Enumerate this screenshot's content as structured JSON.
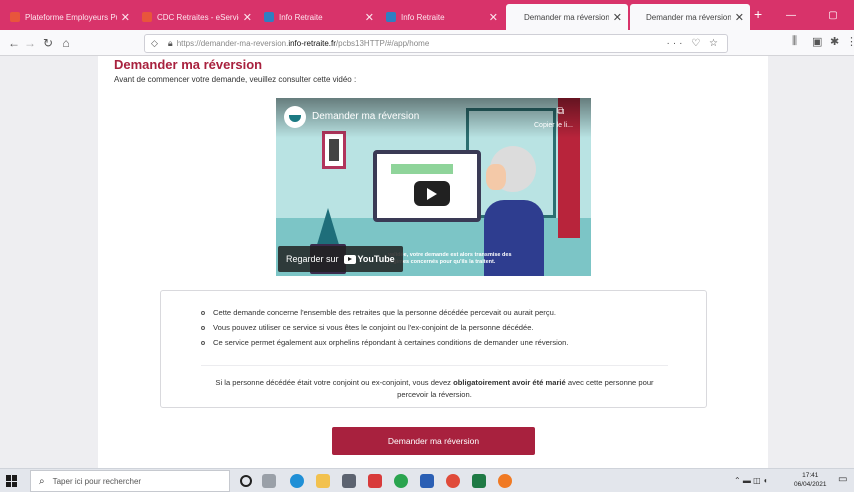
{
  "browser": {
    "tabs": [
      {
        "title": "Plateforme Employeurs Public",
        "favicon_color": "#e8553c"
      },
      {
        "title": "CDC Retraites - eServices",
        "favicon_color": "#e8553c"
      },
      {
        "title": "Info Retraite",
        "favicon_color": "#2f7fc1"
      },
      {
        "title": "Info Retraite",
        "favicon_color": "#2f7fc1"
      },
      {
        "title": "Demander ma réversion en lig",
        "favicon_color": "#2f7fc1"
      },
      {
        "title": "Demander ma réversion en lig",
        "favicon_color": "#2f7fc1"
      }
    ],
    "new_tab": "+",
    "url_prefix": "https://demander-ma-reversion.",
    "url_host": "info-retraite.fr",
    "url_path": "/pcbs13HTTP/#/app/home"
  },
  "page": {
    "title": "Demander ma réversion",
    "intro": "Avant de commencer votre demande, veuillez consulter cette vidéo :",
    "video": {
      "title": "Demander ma réversion",
      "copy_label": "Copier le li...",
      "watch_label": "Regarder sur",
      "youtube_label": "YouTube",
      "caption": "validée, votre demande est alors transmise des régimes concernés pour qu'ils la traitent."
    },
    "bullets": [
      "Cette demande concerne l'ensemble des retraites que la personne décédée percevait ou aurait perçu.",
      "Vous pouvez utiliser ce service si vous êtes le conjoint ou l'ex-conjoint de la personne décédée.",
      "Ce service permet également aux orphelins répondant à certaines conditions de demander une réversion."
    ],
    "note_before": "Si la personne décédée était votre conjoint ou ex-conjoint, vous devez ",
    "note_bold": "obligatoirement avoir été marié",
    "note_after": " avec cette personne pour percevoir la réversion.",
    "cta_label": "Demander ma réversion"
  },
  "taskbar": {
    "search_placeholder": "Taper ici pour rechercher",
    "time": "17:41",
    "date": "06/04/2021"
  },
  "colors": {
    "accent": "#a8213e",
    "tabbar": "#d8336a"
  }
}
